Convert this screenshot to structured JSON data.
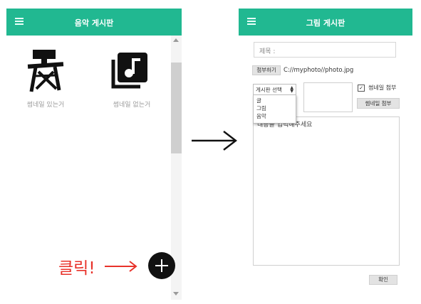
{
  "left_screen": {
    "title": "음악 게시판",
    "items": [
      {
        "caption": "썸네일 있는거",
        "icon": "director-chair-icon"
      },
      {
        "caption": "썸네일 없는거",
        "icon": "music-library-icon"
      }
    ],
    "click_label": "클릭!",
    "fab_icon": "add-icon"
  },
  "right_screen": {
    "title": "그림 게시판",
    "title_placeholder": "제목 :",
    "attach_button": "첨부하기",
    "attached_path": "C://myphoto//photo.jpg",
    "board_select": {
      "selected": "게시판 선택",
      "options": [
        "글",
        "그림",
        "음악"
      ]
    },
    "thumbnail_checkbox_label": "썸네일 첨부",
    "thumbnail_checked": true,
    "thumbnail_attach_button": "썸네일 첨부",
    "content_placeholder": "내용을 입력해주세요",
    "confirm_button": "확인"
  },
  "colors": {
    "appbar": "#21b891",
    "fab": "#111111",
    "annotation": "#e8322a"
  }
}
